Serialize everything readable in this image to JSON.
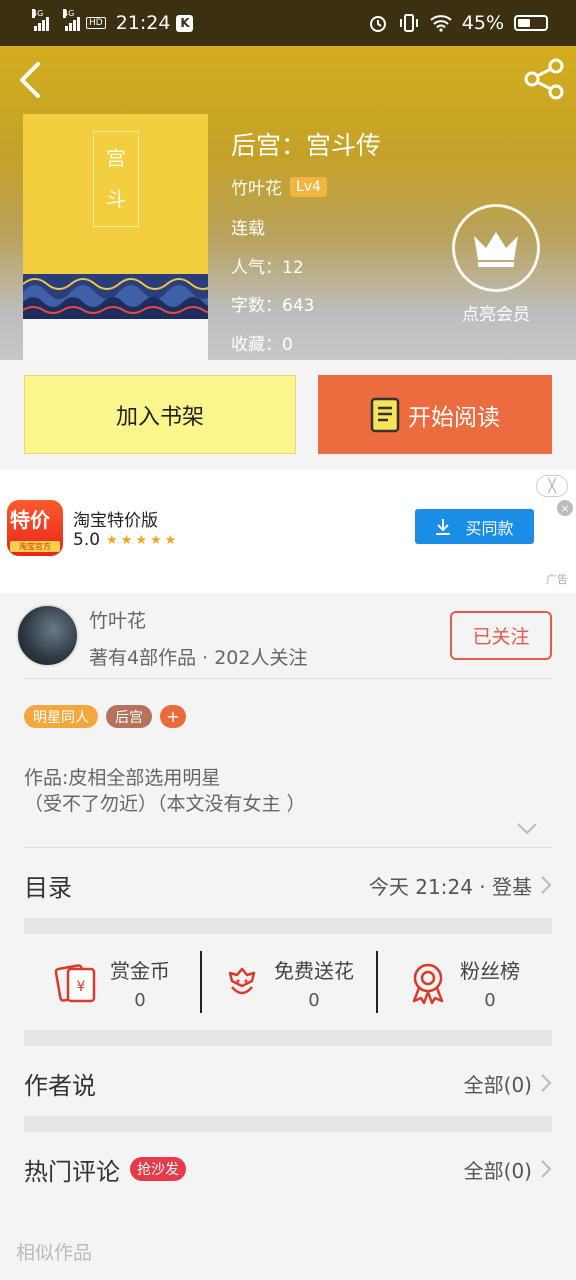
{
  "status_bar": {
    "network1": "4G",
    "network2": "4G",
    "hd": "HD",
    "time": "21:24",
    "k_badge": "K",
    "battery": "45%"
  },
  "book": {
    "title": "后宫：宫斗传",
    "author": "竹叶花",
    "level": "Lv4",
    "status": "连载",
    "popularity": "人气：12",
    "word_count": "字数：643",
    "favorites": "收藏：0",
    "cover": {
      "char1": "宫",
      "char2": "斗"
    }
  },
  "vip": {
    "label": "点亮会员"
  },
  "actions": {
    "add_shelf": "加入书架",
    "start_read": "开始阅读"
  },
  "ad": {
    "icon_text_top": "特价",
    "icon_text_bottom": "淘宝官方",
    "app_name": "淘宝特价版",
    "rating": "5.0",
    "stars": "★★★★★",
    "buy_label": "买同款",
    "close_top": "╳",
    "close_x": "×",
    "ad_tag": "广告"
  },
  "author_card": {
    "name": "竹叶花",
    "stats": "著有4部作品 · 202人关注",
    "follow_label": "已关注"
  },
  "tags": [
    {
      "label": "明星同人",
      "color": "#f1a93f"
    },
    {
      "label": "后宫",
      "color": "#b5735a"
    }
  ],
  "tag_plus": "+",
  "description": {
    "line1": "作品:皮相全部选用明星",
    "line2": "（受不了勿近）（本文没有女主 ）"
  },
  "catalog": {
    "title": "目录",
    "latest": "今天 21:24 · 登基"
  },
  "rewards": [
    {
      "label": "赏金币",
      "count": "0"
    },
    {
      "label": "免费送花",
      "count": "0"
    },
    {
      "label": "粉丝榜",
      "count": "0"
    }
  ],
  "author_says": {
    "title": "作者说",
    "all": "全部(0)"
  },
  "hot_comments": {
    "title": "热门评论",
    "badge": "抢沙发",
    "all": "全部(0)"
  },
  "similar": {
    "title": "相似作品"
  },
  "colors": {
    "accent": "#ec6b3f",
    "header_gold": "#d4ad1e",
    "shelf_btn": "#fdf58d",
    "follow": "#e8594a",
    "ad_blue": "#1a8ee6",
    "icon_red": "#d93a2b"
  }
}
